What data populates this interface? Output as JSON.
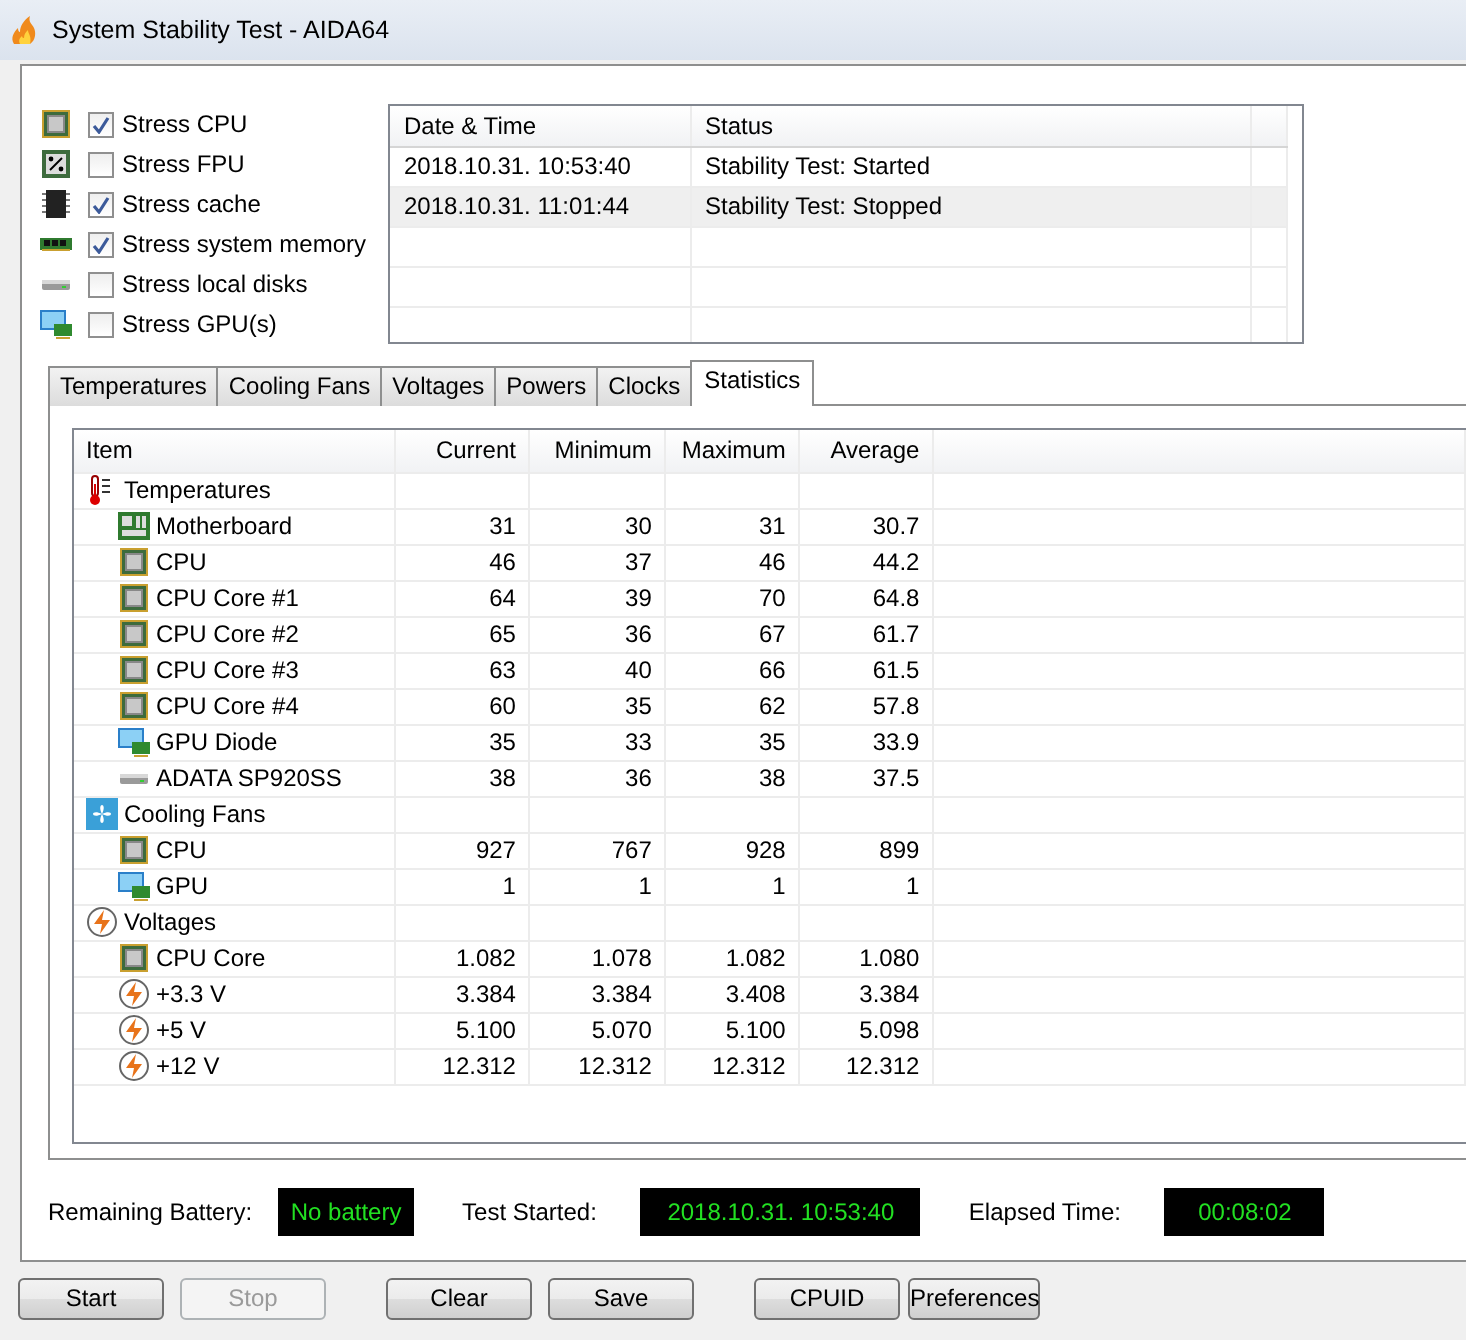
{
  "window": {
    "title": "System Stability Test - AIDA64"
  },
  "stress_options": [
    {
      "label": "Stress CPU",
      "kind": "cpu",
      "checked": true
    },
    {
      "label": "Stress FPU",
      "kind": "fpu",
      "checked": false
    },
    {
      "label": "Stress cache",
      "kind": "cache",
      "checked": true
    },
    {
      "label": "Stress system memory",
      "kind": "memory",
      "checked": true
    },
    {
      "label": "Stress local disks",
      "kind": "disk",
      "checked": false
    },
    {
      "label": "Stress GPU(s)",
      "kind": "gpu",
      "checked": false
    }
  ],
  "log": {
    "columns": [
      "Date & Time",
      "Status"
    ],
    "rows": [
      {
        "time": "2018.10.31. 10:53:40",
        "status": "Stability Test: Started",
        "selected": false
      },
      {
        "time": "2018.10.31. 11:01:44",
        "status": "Stability Test: Stopped",
        "selected": true
      }
    ]
  },
  "tabs": [
    {
      "label": "Temperatures",
      "selected": false
    },
    {
      "label": "Cooling Fans",
      "selected": false
    },
    {
      "label": "Voltages",
      "selected": false
    },
    {
      "label": "Powers",
      "selected": false
    },
    {
      "label": "Clocks",
      "selected": false
    },
    {
      "label": "Statistics",
      "selected": true
    }
  ],
  "statistics": {
    "columns": [
      "Item",
      "Current",
      "Minimum",
      "Maximum",
      "Average"
    ],
    "groups": [
      {
        "label": "Temperatures",
        "kind": "thermometer",
        "children": [
          {
            "label": "Motherboard",
            "kind": "board",
            "values": [
              "31",
              "30",
              "31",
              "30.7"
            ]
          },
          {
            "label": "CPU",
            "kind": "cpu",
            "values": [
              "46",
              "37",
              "46",
              "44.2"
            ]
          },
          {
            "label": "CPU Core #1",
            "kind": "cpu",
            "values": [
              "64",
              "39",
              "70",
              "64.8"
            ]
          },
          {
            "label": "CPU Core #2",
            "kind": "cpu",
            "values": [
              "65",
              "36",
              "67",
              "61.7"
            ]
          },
          {
            "label": "CPU Core #3",
            "kind": "cpu",
            "values": [
              "63",
              "40",
              "66",
              "61.5"
            ]
          },
          {
            "label": "CPU Core #4",
            "kind": "cpu",
            "values": [
              "60",
              "35",
              "62",
              "57.8"
            ]
          },
          {
            "label": "GPU Diode",
            "kind": "gpu",
            "values": [
              "35",
              "33",
              "35",
              "33.9"
            ]
          },
          {
            "label": "ADATA SP920SS",
            "kind": "disk",
            "values": [
              "38",
              "36",
              "38",
              "37.5"
            ]
          }
        ]
      },
      {
        "label": "Cooling Fans",
        "kind": "fan",
        "children": [
          {
            "label": "CPU",
            "kind": "cpu",
            "values": [
              "927",
              "767",
              "928",
              "899"
            ]
          },
          {
            "label": "GPU",
            "kind": "gpu",
            "values": [
              "1",
              "1",
              "1",
              "1"
            ]
          }
        ]
      },
      {
        "label": "Voltages",
        "kind": "bolt",
        "children": [
          {
            "label": "CPU Core",
            "kind": "cpu",
            "values": [
              "1.082",
              "1.078",
              "1.082",
              "1.080"
            ]
          },
          {
            "label": "+3.3 V",
            "kind": "bolt",
            "values": [
              "3.384",
              "3.384",
              "3.408",
              "3.384"
            ]
          },
          {
            "label": "+5 V",
            "kind": "bolt",
            "values": [
              "5.100",
              "5.070",
              "5.100",
              "5.098"
            ]
          },
          {
            "label": "+12 V",
            "kind": "bolt",
            "values": [
              "12.312",
              "12.312",
              "12.312",
              "12.312"
            ]
          }
        ]
      }
    ]
  },
  "info": [
    {
      "label": "Remaining Battery:",
      "value": "No battery"
    },
    {
      "label": "Test Started:",
      "value": "2018.10.31. 10:53:40"
    },
    {
      "label": "Elapsed Time:",
      "value": "00:08:02"
    }
  ],
  "buttons": [
    {
      "label": "Start",
      "disabled": false
    },
    {
      "label": "Stop",
      "disabled": true
    },
    {
      "label": "Clear",
      "disabled": false
    },
    {
      "label": "Save",
      "disabled": false
    },
    {
      "label": "CPUID",
      "disabled": false
    },
    {
      "label": "Preferences",
      "disabled": false
    }
  ]
}
